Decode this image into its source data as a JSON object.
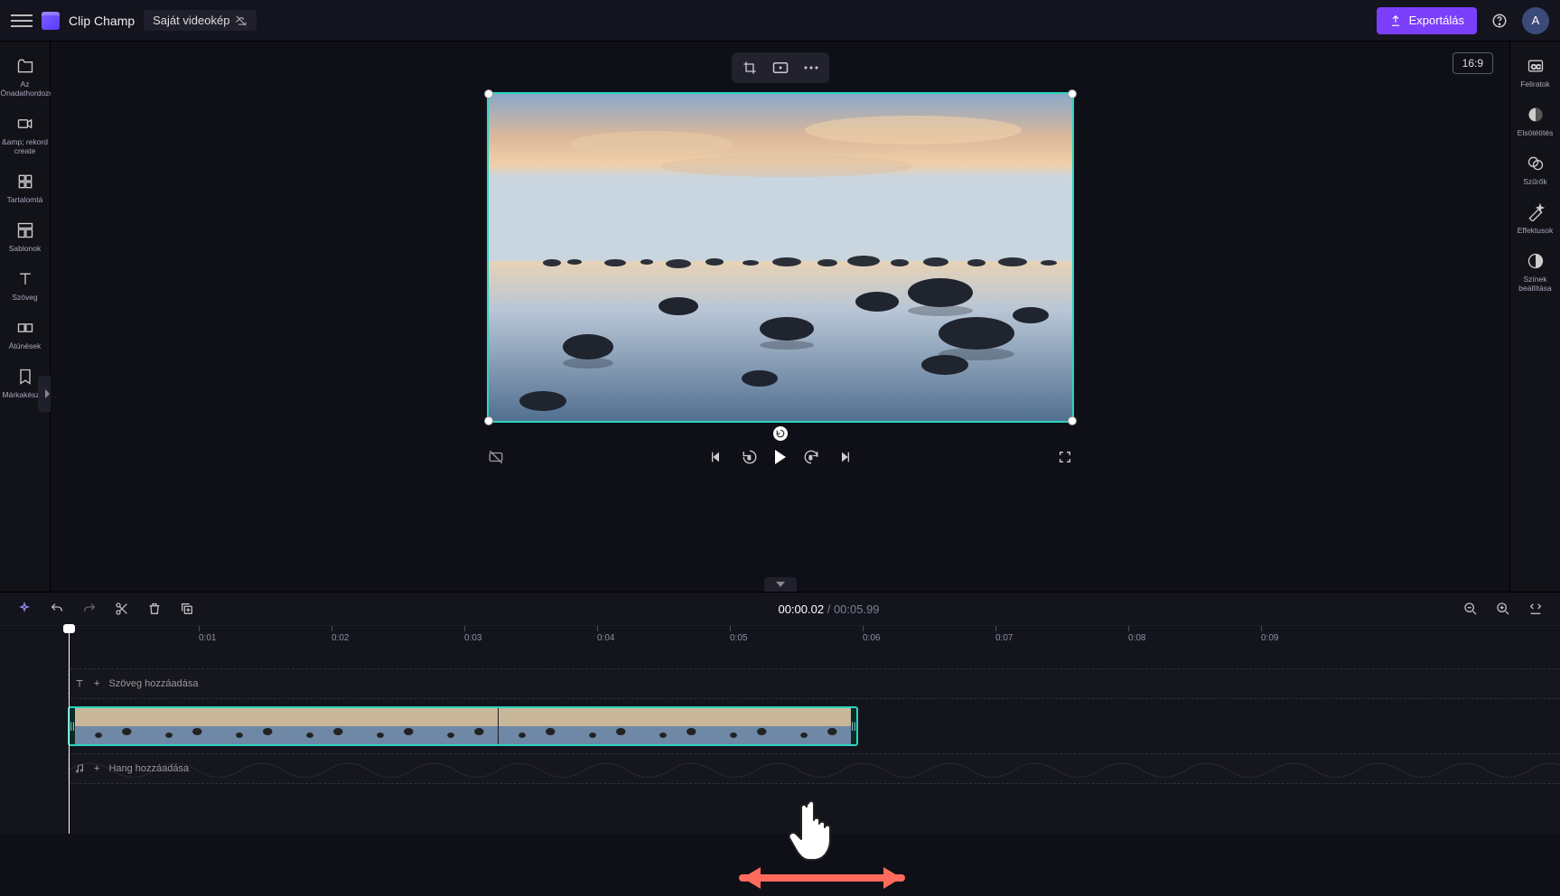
{
  "header": {
    "brand": "Clip Champ",
    "project_name": "Saját videokép",
    "export_label": "Exportálás",
    "avatar_letter": "A"
  },
  "aspect_chip": "16:9",
  "left_sidebar": {
    "items": [
      {
        "icon": "media-icon",
        "label": "Az Önadathordozója"
      },
      {
        "icon": "camera-icon",
        "label": "&amp; rekord create"
      },
      {
        "icon": "library-icon",
        "label": "Tartalomtá"
      },
      {
        "icon": "templates-icon",
        "label": "Sablonok"
      },
      {
        "icon": "text-icon",
        "label": "Szöveg"
      },
      {
        "icon": "transitions-icon",
        "label": "Átúnések"
      },
      {
        "icon": "brandkit-icon",
        "label": "Márkakészlet"
      }
    ]
  },
  "right_sidebar": {
    "items": [
      {
        "icon": "captions-icon",
        "label": "Feliratok"
      },
      {
        "icon": "fade-icon",
        "label": "Elsötétítés"
      },
      {
        "icon": "filters-icon",
        "label": "Szűrők"
      },
      {
        "icon": "effects-icon",
        "label": "Effektusok"
      },
      {
        "icon": "colors-icon",
        "label": "Színek beállítása"
      }
    ]
  },
  "playbar": {
    "screenshot_hidden": "false"
  },
  "timeline": {
    "current_time": "00:00.02",
    "duration": "00:05.99",
    "ticks": [
      "0:01",
      "0:02",
      "0:03",
      "0:04",
      "0:05",
      "0:06",
      "0:07",
      "0:08",
      "0:09"
    ],
    "text_track_label": "Szöveg hozzáadása",
    "audio_track_label": "Hang hozzáadása"
  },
  "colors": {
    "accent": "#7b3ffb",
    "clip_border": "#2dd4bf"
  }
}
